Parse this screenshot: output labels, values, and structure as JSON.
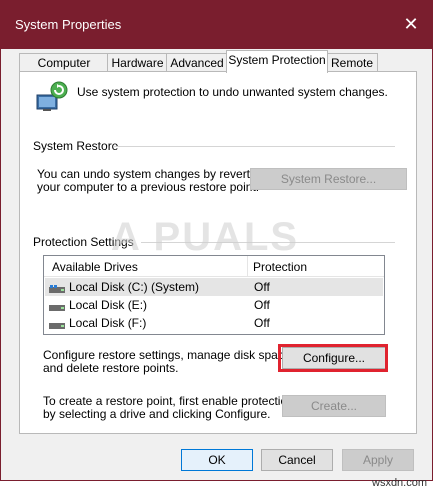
{
  "window": {
    "title": "System Properties",
    "close_glyph": "✕"
  },
  "tabs": [
    {
      "label": "Computer Name"
    },
    {
      "label": "Hardware"
    },
    {
      "label": "Advanced"
    },
    {
      "label": "System Protection",
      "active": true
    },
    {
      "label": "Remote"
    }
  ],
  "intro": {
    "text": "Use system protection to undo unwanted system changes.",
    "icon": "system-protection-icon"
  },
  "system_restore": {
    "heading": "System Restore",
    "desc_line1": "You can undo system changes by reverting",
    "desc_line2": "your computer to a previous restore point.",
    "button": "System Restore..."
  },
  "protection": {
    "heading": "Protection Settings",
    "columns": [
      "Available Drives",
      "Protection"
    ],
    "rows": [
      {
        "drive": "Local Disk (C:) (System)",
        "protection": "Off",
        "icon": "system-drive-icon"
      },
      {
        "drive": "Local Disk (E:)",
        "protection": "Off",
        "icon": "drive-icon"
      },
      {
        "drive": "Local Disk (F:)",
        "protection": "Off",
        "icon": "drive-icon"
      }
    ],
    "configure_line1": "Configure restore settings, manage disk space,",
    "configure_line2": "and delete restore points.",
    "configure_button": "Configure...",
    "create_line1": "To create a restore point, first enable protection",
    "create_line2": "by selecting a drive and clicking Configure.",
    "create_button": "Create..."
  },
  "footer": {
    "ok": "OK",
    "cancel": "Cancel",
    "apply": "Apply"
  },
  "watermark": "A PUALS",
  "site": "wsxdn.com",
  "colors": {
    "titlebar": "#7a1e2e",
    "highlight": "#e0232f"
  }
}
